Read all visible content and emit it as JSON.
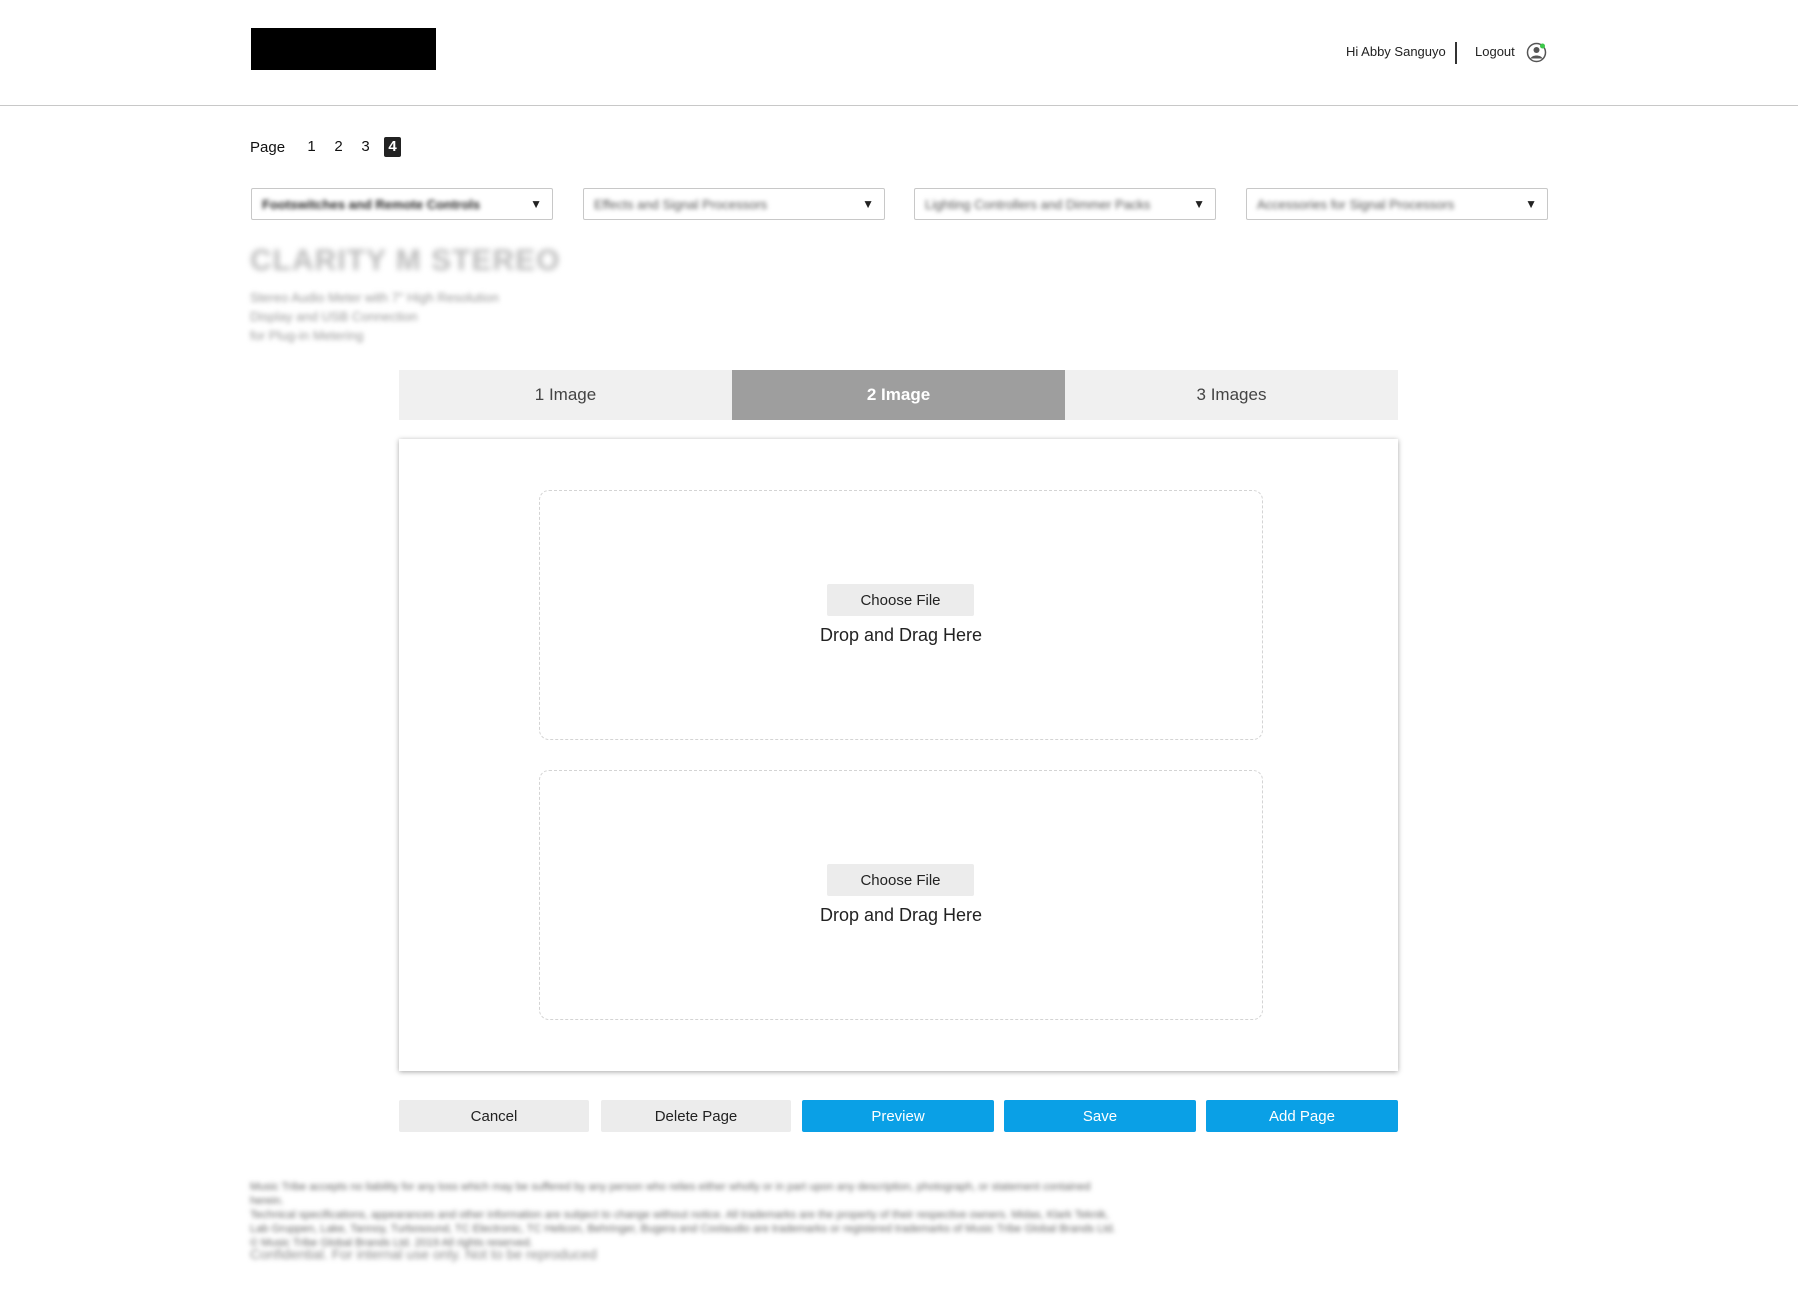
{
  "header": {
    "greeting": "Hi Abby Sanguyo",
    "logout_label": "Logout",
    "user_icon": "user-circle-icon"
  },
  "pager": {
    "label": "Page",
    "pages": [
      "1",
      "2",
      "3",
      "4"
    ],
    "active_page": "4"
  },
  "filters": [
    {
      "selected": "Footswitches and Remote Controls"
    },
    {
      "selected": "Effects and Signal Processors"
    },
    {
      "selected": "Lighting Controllers and Dimmer Packs"
    },
    {
      "selected": "Accessories for Signal Processors"
    }
  ],
  "product": {
    "title": "CLARITY M STEREO",
    "description_lines": [
      "Stereo Audio Meter with 7\" High Resolution",
      "Display and USB Connection",
      "for Plug-in Metering"
    ]
  },
  "layout_tabs": [
    {
      "label": "1 Image",
      "active": false
    },
    {
      "label": "2 Image",
      "active": true
    },
    {
      "label": "3 Images",
      "active": false
    }
  ],
  "dropzones": [
    {
      "button_label": "Choose File",
      "hint": "Drop and Drag Here"
    },
    {
      "button_label": "Choose File",
      "hint": "Drop and Drag Here"
    }
  ],
  "actions": {
    "cancel": "Cancel",
    "delete_page": "Delete Page",
    "preview": "Preview",
    "save": "Save",
    "add_page": "Add Page"
  },
  "footer": {
    "legal_lines": [
      "Music Tribe accepts no liability for any loss which may be suffered by any person who relies either wholly or in part upon any description, photograph, or statement contained herein.",
      "Technical specifications, appearances and other information are subject to change without notice. All trademarks are the property of their respective owners. Midas, Klark Teknik,",
      "Lab Gruppen, Lake, Tannoy, Turbosound, TC Electronic, TC Helicon, Behringer, Bugera and Coolaudio are trademarks or registered trademarks of Music Tribe Global Brands Ltd.",
      "© Music Tribe Global Brands Ltd. 2019 All rights reserved."
    ],
    "confidential": "Confidential. For internal use only. Not to be reproduced"
  },
  "colors": {
    "accent_blue": "#0aa0e6",
    "tab_active": "#9e9e9e",
    "tab_inactive": "#f0f0f0",
    "button_grey": "#ececec"
  }
}
